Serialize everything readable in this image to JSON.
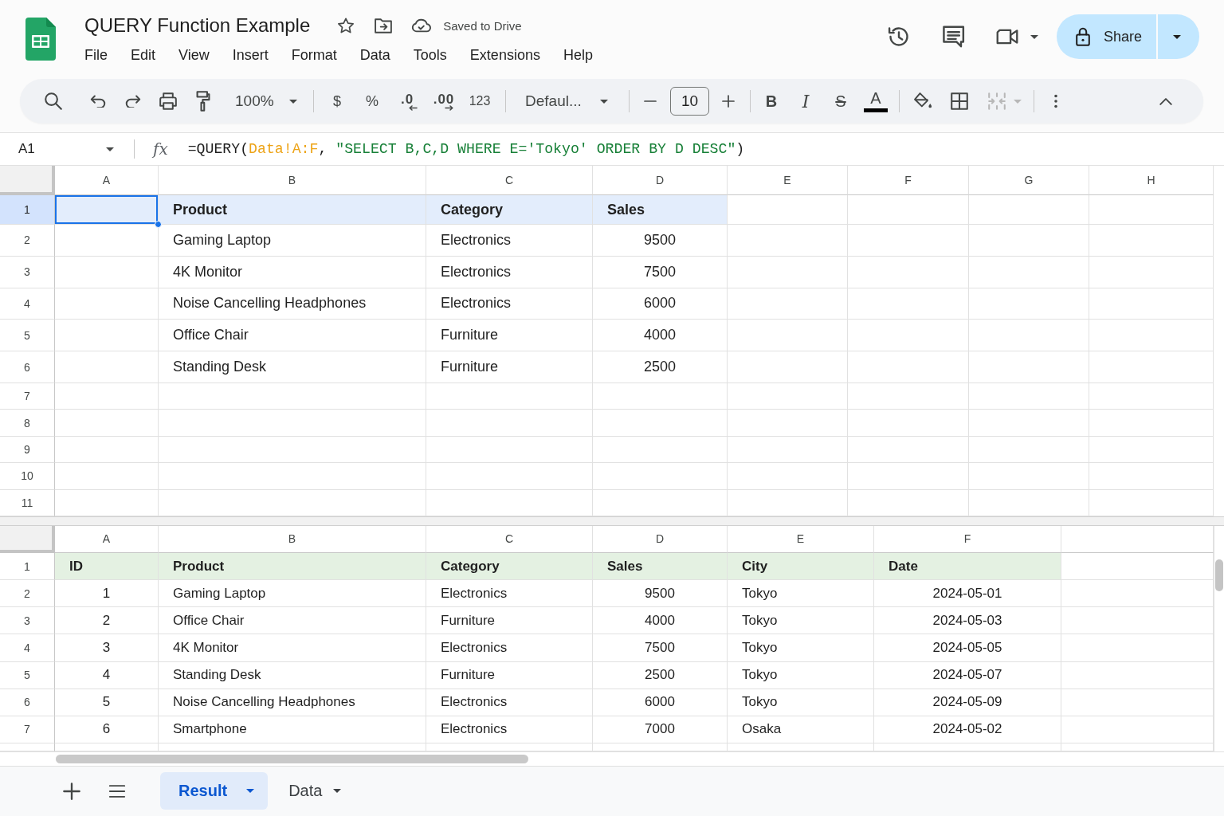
{
  "document": {
    "title": "QUERY Function Example",
    "save_status": "Saved to Drive"
  },
  "menu_bar": [
    "File",
    "Edit",
    "View",
    "Insert",
    "Format",
    "Data",
    "Tools",
    "Extensions",
    "Help"
  ],
  "share_button": {
    "label": "Share"
  },
  "toolbar": {
    "zoom": "100%",
    "currency": "$",
    "percent": "%",
    "decrease_decimal": ".0",
    "increase_decimal": ".00",
    "number_format": "123",
    "font": "Defaul...",
    "font_size": "10",
    "bold": "B",
    "italic": "I",
    "strikethrough": "S",
    "text_color": "A",
    "merge_cells": {
      "disabled": true
    }
  },
  "formula_bar": {
    "cell_ref": "A1",
    "function_label": "fx",
    "formula": [
      {
        "kind": "plain",
        "text": "=QUERY("
      },
      {
        "kind": "range",
        "text": "Data!A:F"
      },
      {
        "kind": "plain",
        "text": ", "
      },
      {
        "kind": "string",
        "text": "\"SELECT B,C,D WHERE E='Tokyo' ORDER BY D DESC\""
      },
      {
        "kind": "plain",
        "text": ")"
      }
    ]
  },
  "panes": [
    {
      "kind": "result",
      "columns": [
        "A",
        "B",
        "C",
        "D",
        "E",
        "F",
        "G",
        "H"
      ],
      "rows": [
        {
          "number": "1",
          "kind": "header",
          "selected": true,
          "product": "Product",
          "category": "Category",
          "sales": "Sales"
        },
        {
          "number": "2",
          "kind": "data",
          "selected": false,
          "product": "Gaming Laptop",
          "category": "Electronics",
          "sales": "9500"
        },
        {
          "number": "3",
          "kind": "data",
          "selected": false,
          "product": "4K Monitor",
          "category": "Electronics",
          "sales": "7500"
        },
        {
          "number": "4",
          "kind": "data",
          "selected": false,
          "product": "Noise Cancelling Headphones",
          "category": "Electronics",
          "sales": "6000"
        },
        {
          "number": "5",
          "kind": "data",
          "selected": false,
          "product": "Office Chair",
          "category": "Furniture",
          "sales": "4000"
        },
        {
          "number": "6",
          "kind": "data",
          "selected": false,
          "product": "Standing Desk",
          "category": "Furniture",
          "sales": "2500"
        },
        {
          "number": "7",
          "kind": "data",
          "selected": false
        },
        {
          "number": "8",
          "kind": "data",
          "selected": false
        },
        {
          "number": "9",
          "kind": "data",
          "selected": false
        },
        {
          "number": "10",
          "kind": "data",
          "selected": false
        },
        {
          "number": "11",
          "kind": "data",
          "selected": false
        }
      ]
    },
    {
      "kind": "source",
      "columns": [
        "A",
        "B",
        "C",
        "D",
        "E",
        "F"
      ],
      "rows": [
        {
          "number": "1",
          "kind": "header",
          "selected": false,
          "id": "ID",
          "product": "Product",
          "category": "Category",
          "sales": "Sales",
          "city": "City",
          "date": "Date"
        },
        {
          "number": "2",
          "kind": "data",
          "selected": false,
          "id": "1",
          "product": "Gaming Laptop",
          "category": "Electronics",
          "sales": "9500",
          "city": "Tokyo",
          "date": "2024-05-01"
        },
        {
          "number": "3",
          "kind": "data",
          "selected": false,
          "id": "2",
          "product": "Office Chair",
          "category": "Furniture",
          "sales": "4000",
          "city": "Tokyo",
          "date": "2024-05-03"
        },
        {
          "number": "4",
          "kind": "data",
          "selected": false,
          "id": "3",
          "product": "4K Monitor",
          "category": "Electronics",
          "sales": "7500",
          "city": "Tokyo",
          "date": "2024-05-05"
        },
        {
          "number": "5",
          "kind": "data",
          "selected": false,
          "id": "4",
          "product": "Standing Desk",
          "category": "Furniture",
          "sales": "2500",
          "city": "Tokyo",
          "date": "2024-05-07"
        },
        {
          "number": "6",
          "kind": "data",
          "selected": false,
          "id": "5",
          "product": "Noise Cancelling Headphones",
          "category": "Electronics",
          "sales": "6000",
          "city": "Tokyo",
          "date": "2024-05-09"
        },
        {
          "number": "7",
          "kind": "data",
          "selected": false,
          "id": "6",
          "product": "Smartphone",
          "category": "Electronics",
          "sales": "7000",
          "city": "Osaka",
          "date": "2024-05-02"
        }
      ]
    }
  ],
  "sheet_tabs": [
    {
      "label": "Result",
      "selected": true
    },
    {
      "label": "Data",
      "selected": false
    }
  ]
}
